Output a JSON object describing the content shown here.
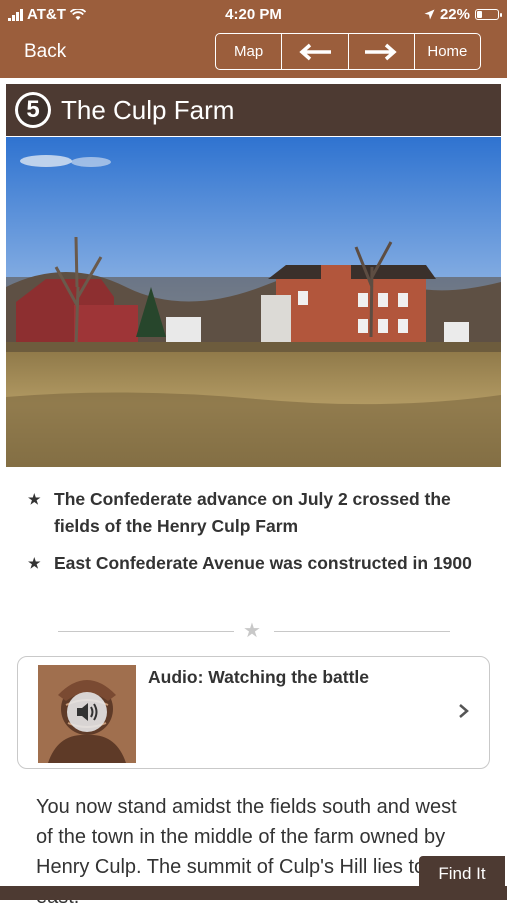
{
  "status_bar": {
    "carrier": "AT&T",
    "time": "4:20 PM",
    "battery": "22%"
  },
  "nav": {
    "back_label": "Back",
    "map_label": "Map",
    "prev_icon": "arrow-left-icon",
    "next_icon": "arrow-right-icon",
    "home_label": "Home"
  },
  "stop": {
    "number": "5",
    "title": "The Culp Farm"
  },
  "photo": {
    "description_icon": "farm-photo"
  },
  "facts": [
    "The Confederate advance on July 2 crossed the fields of the Henry Culp Farm",
    "East Confederate Avenue was constructed in 1900"
  ],
  "audio": {
    "title": "Audio: Watching the battle",
    "icon": "speaker-icon"
  },
  "body_text": "You now stand amidst the fields south and west of the town in the middle of the farm owned by Henry Culp.  The summit of Culp's Hill lies to the east.",
  "find_it_label": "Find It",
  "colors": {
    "header_brown": "#9b5e3c",
    "title_dark": "#4d3a32"
  }
}
